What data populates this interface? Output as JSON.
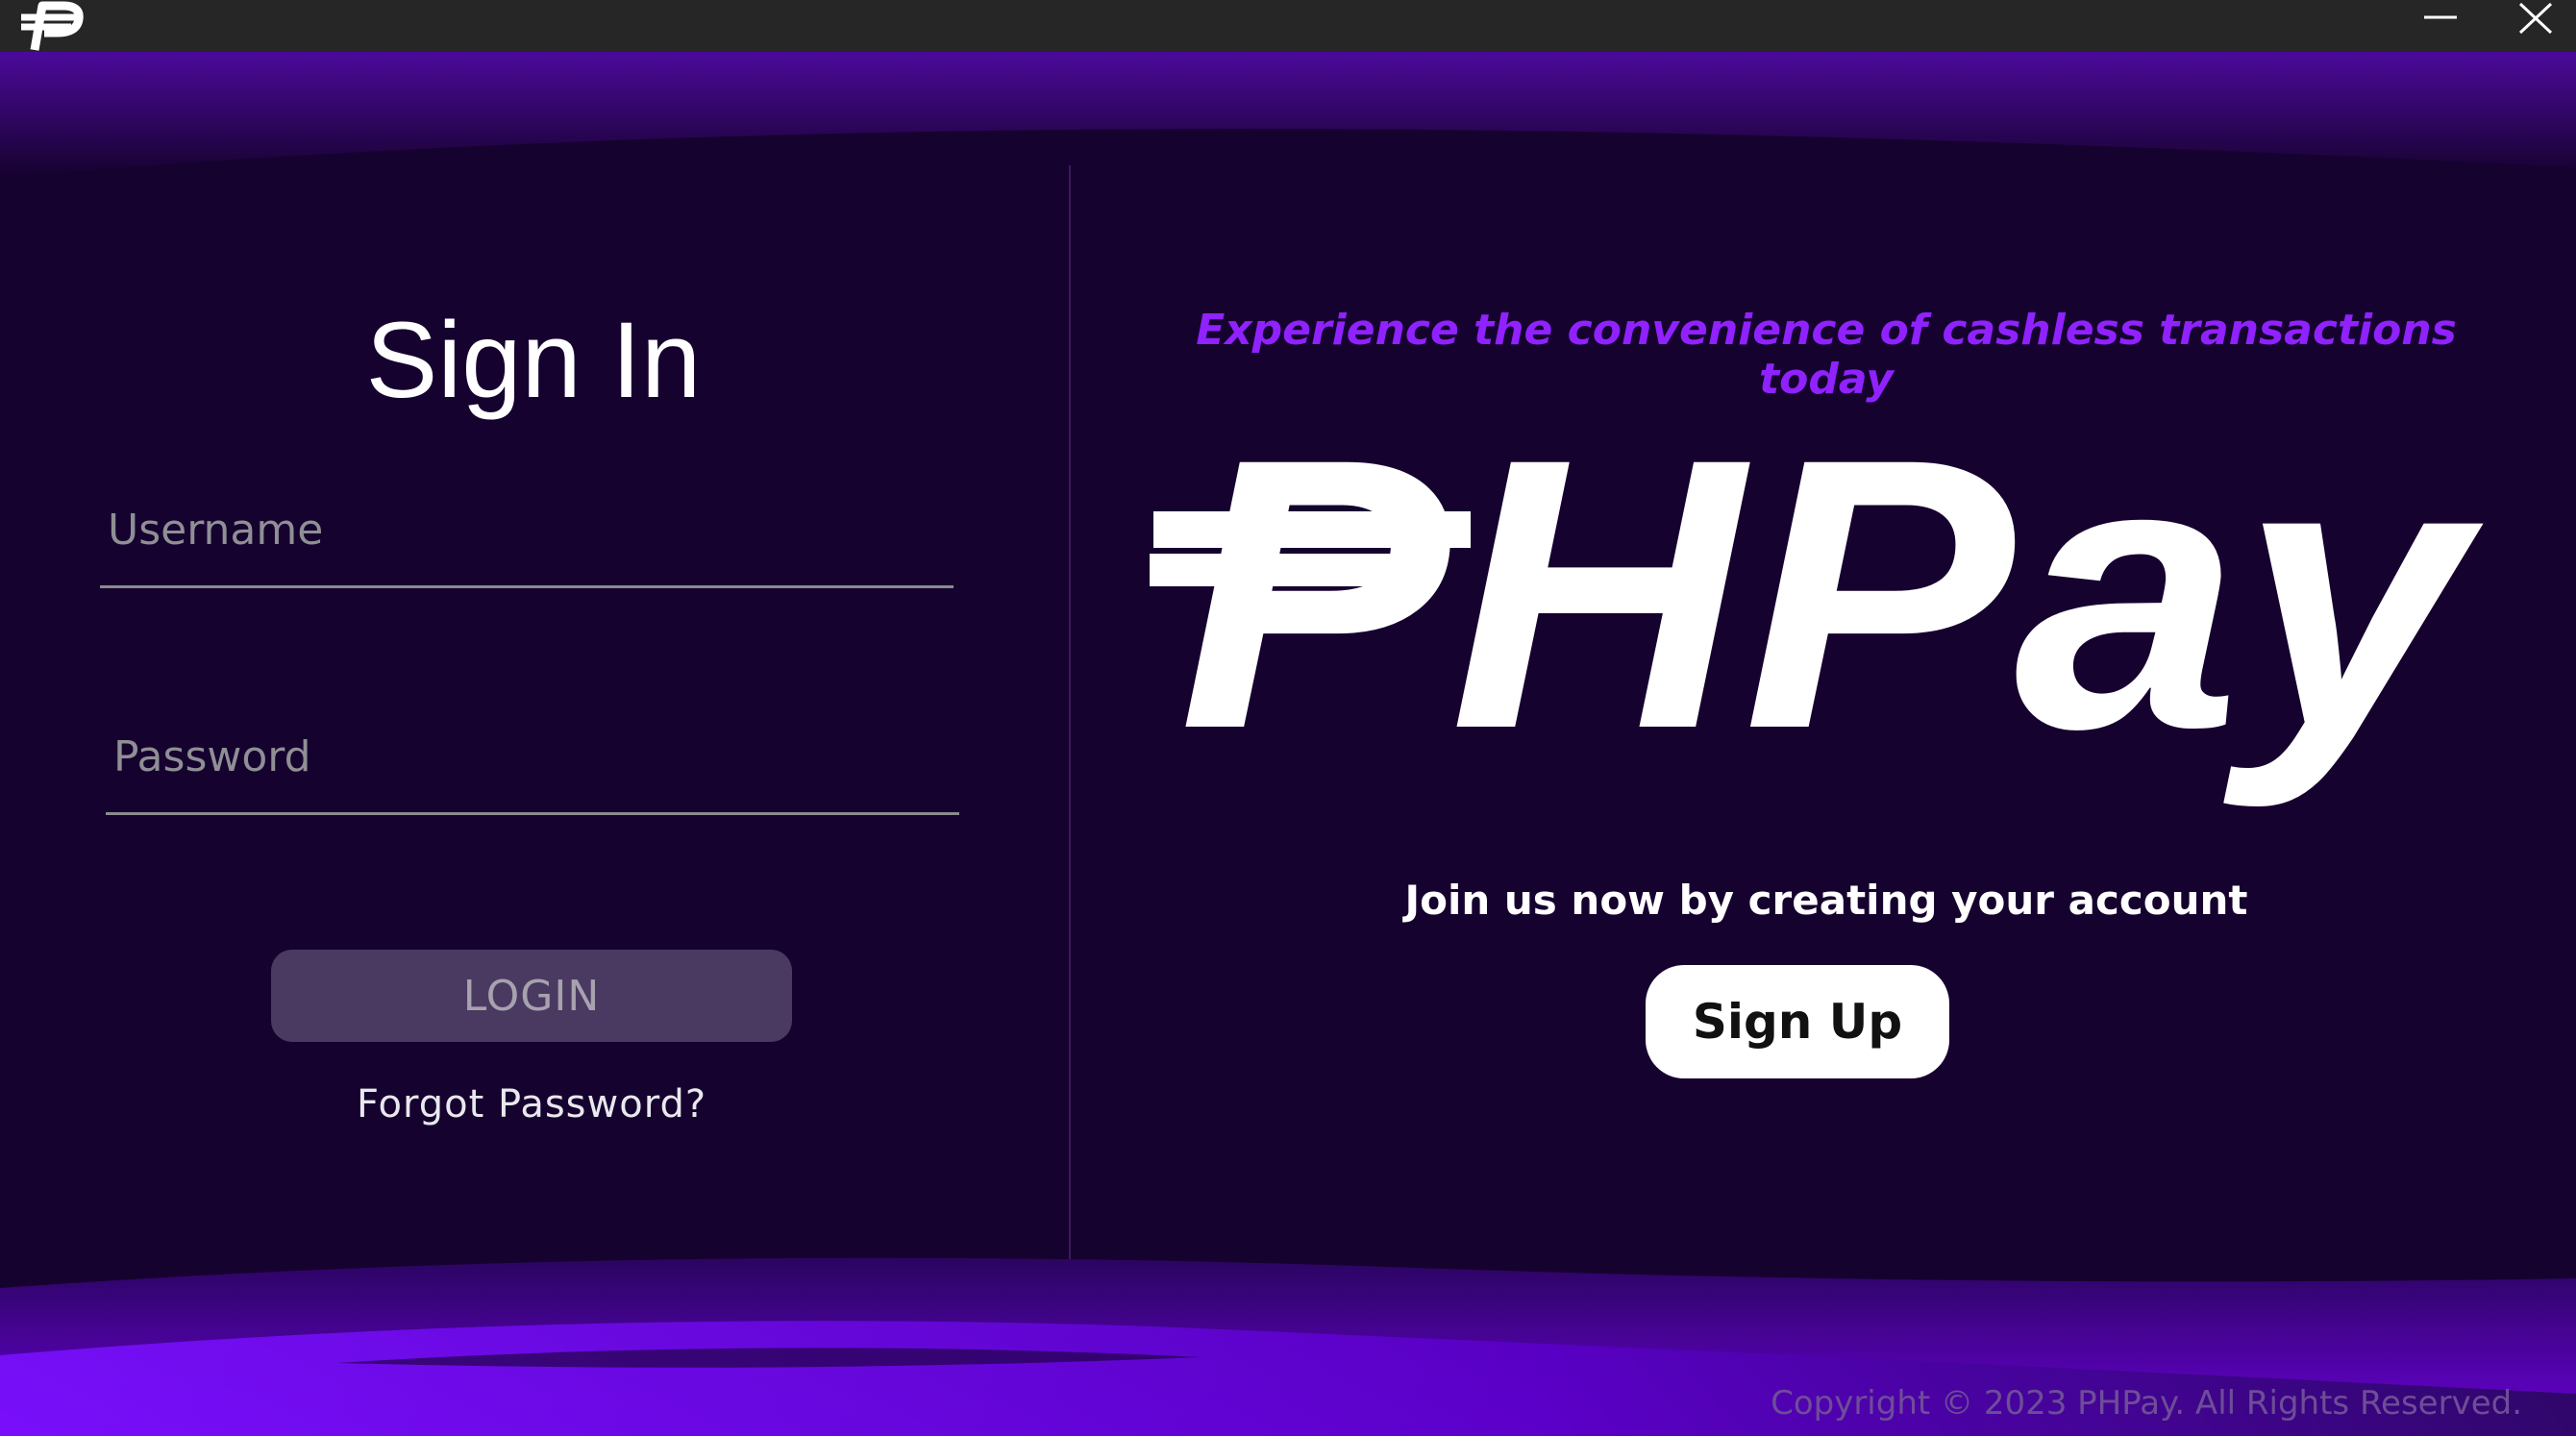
{
  "window": {
    "app_icon": "peso-p-logo-icon",
    "minimize_icon": "minimize-icon",
    "close_icon": "close-icon"
  },
  "login": {
    "title": "Sign In",
    "username_placeholder": "Username",
    "password_placeholder": "Password",
    "login_label": "LOGIN",
    "forgot_label": "Forgot Password?"
  },
  "promo": {
    "tagline": "Experience the convenience of cashless transactions today",
    "brand": "PHPay",
    "join_text": "Join us now by creating your account",
    "signup_label": "Sign Up"
  },
  "footer": {
    "copyright": "Copyright © 2023 PHPay. All Rights Reserved."
  },
  "colors": {
    "background": "#16022f",
    "accent_purple": "#8f22ff",
    "band_purple": "#5b00c9",
    "titlebar": "#262626"
  }
}
